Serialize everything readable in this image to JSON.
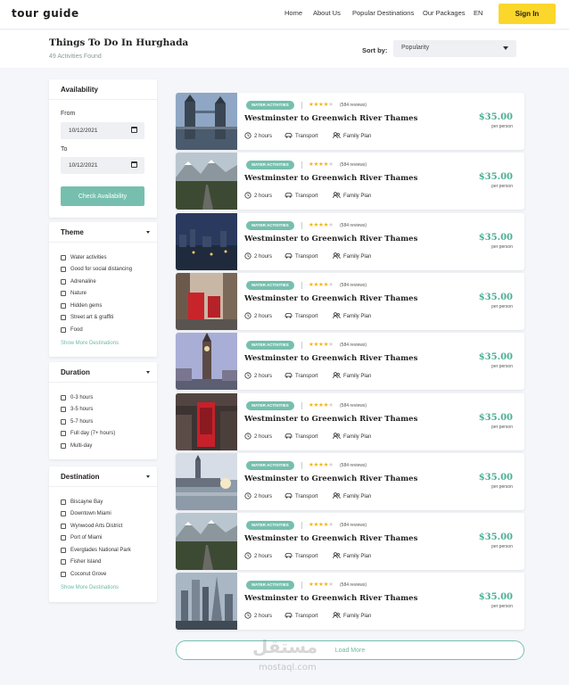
{
  "header": {
    "logo": "tour guide",
    "nav": [
      "Home",
      "About Us",
      "Popular Destinations",
      "Our Packages",
      "EN"
    ],
    "signin_label": "Sign In",
    "accent_color": "#fbd72b"
  },
  "page": {
    "title": "Things To Do In Hurghada",
    "count": "49 Activities Found",
    "sort_label": "Sort by:",
    "sort_value": "Popularity"
  },
  "sidebar": {
    "availability": {
      "title": "Availability",
      "from_label": "From",
      "from_value": "10/12/2021",
      "to_label": "To",
      "to_value": "10/12/2021",
      "button_label": "Check Availability"
    },
    "theme": {
      "title": "Theme",
      "options": [
        "Water activities",
        "Good for social distancing",
        "Adrenaline",
        "Nature",
        "Hidden gems",
        "Street art & graffiti",
        "Food"
      ],
      "more_label": "Show More Destinations"
    },
    "duration": {
      "title": "Duration",
      "options": [
        "0-3 hours",
        "3-5 hours",
        "5-7 hours",
        "Full day (7+ hours)",
        "Multi-day"
      ]
    },
    "destination": {
      "title": "Destination",
      "options": [
        "Biscayne Bay",
        "Downtown Miami",
        "Wynwood Arts District",
        "Port of Miami",
        "Everglades National Park",
        "Fisher Island",
        "Coconut Grove"
      ],
      "more_label": "Show More Destinations"
    }
  },
  "cards": [
    {
      "badge": "WATER ACTIVITIES",
      "rating": 4,
      "reviews": "(584 reviews)",
      "title": "Westminster to Greenwich River Thames",
      "duration": "2 hours",
      "transport": "Transport",
      "plan": "Family Plan",
      "price": "$35.00",
      "per": "per person",
      "image": "tower-bridge"
    },
    {
      "badge": "WATER ACTIVITIES",
      "rating": 4,
      "reviews": "(584 reviews)",
      "title": "Westminster to Greenwich River Thames",
      "duration": "2 hours",
      "transport": "Transport",
      "plan": "Family Plan",
      "price": "$35.00",
      "per": "per person",
      "image": "mountain-road"
    },
    {
      "badge": "WATER ACTIVITIES",
      "rating": 4,
      "reviews": "(584 reviews)",
      "title": "Westminster to Greenwich River Thames",
      "duration": "2 hours",
      "transport": "Transport",
      "plan": "Family Plan",
      "price": "$35.00",
      "per": "per person",
      "image": "city-night"
    },
    {
      "badge": "WATER ACTIVITIES",
      "rating": 4,
      "reviews": "(584 reviews)",
      "title": "Westminster to Greenwich River Thames",
      "duration": "2 hours",
      "transport": "Transport",
      "plan": "Family Plan",
      "price": "$35.00",
      "per": "per person",
      "image": "red-buses"
    },
    {
      "badge": "WATER ACTIVITIES",
      "rating": 4,
      "reviews": "(584 reviews)",
      "title": "Westminster to Greenwich River Thames",
      "duration": "2 hours",
      "transport": "Transport",
      "plan": "Family Plan",
      "price": "$35.00",
      "per": "per person",
      "image": "big-ben"
    },
    {
      "badge": "WATER ACTIVITIES",
      "rating": 4,
      "reviews": "(584 reviews)",
      "title": "Westminster to Greenwich River Thames",
      "duration": "2 hours",
      "transport": "Transport",
      "plan": "Family Plan",
      "price": "$35.00",
      "per": "per person",
      "image": "phone-booth"
    },
    {
      "badge": "WATER ACTIVITIES",
      "rating": 4,
      "reviews": "(584 reviews)",
      "title": "Westminster to Greenwich River Thames",
      "duration": "2 hours",
      "transport": "Transport",
      "plan": "Family Plan",
      "price": "$35.00",
      "per": "per person",
      "image": "westminster-sunset"
    },
    {
      "badge": "WATER ACTIVITIES",
      "rating": 4,
      "reviews": "(584 reviews)",
      "title": "Westminster to Greenwich River Thames",
      "duration": "2 hours",
      "transport": "Transport",
      "plan": "Family Plan",
      "price": "$35.00",
      "per": "per person",
      "image": "mountain-road"
    },
    {
      "badge": "WATER ACTIVITIES",
      "rating": 4,
      "reviews": "(584 reviews)",
      "title": "Westminster to Greenwich River Thames",
      "duration": "2 hours",
      "transport": "Transport",
      "plan": "Family Plan",
      "price": "$35.00",
      "per": "per person",
      "image": "city-skyline"
    }
  ],
  "load_more_label": "Load More",
  "watermark": {
    "text": "مستقل",
    "sub": "mostaql.com"
  },
  "colors": {
    "teal": "#76bfae",
    "price": "#4caf93",
    "star": "#f2b61e",
    "background": "#f4f6fa"
  }
}
